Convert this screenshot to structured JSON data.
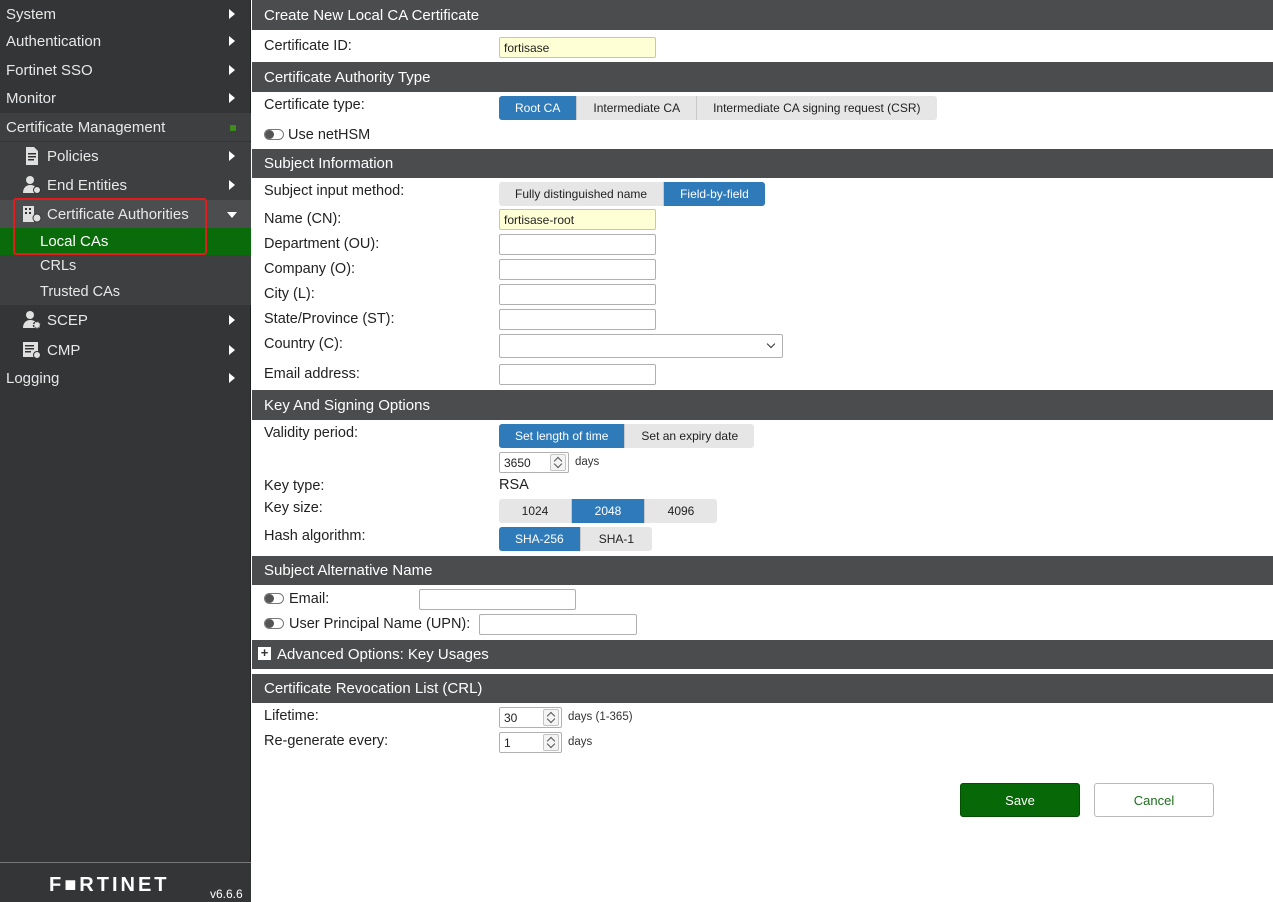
{
  "sidebar": {
    "items": [
      {
        "label": "System"
      },
      {
        "label": "Authentication"
      },
      {
        "label": "Fortinet SSO"
      },
      {
        "label": "Monitor"
      },
      {
        "label": "Certificate Management"
      },
      {
        "label": "Policies"
      },
      {
        "label": "End Entities"
      },
      {
        "label": "Certificate Authorities"
      },
      {
        "label": "Local CAs"
      },
      {
        "label": "CRLs"
      },
      {
        "label": "Trusted CAs"
      },
      {
        "label": "SCEP"
      },
      {
        "label": "CMP"
      },
      {
        "label": "Logging"
      }
    ],
    "brand": "F■RTINET",
    "version": "v6.6.6"
  },
  "form": {
    "title": "Create New Local CA Certificate",
    "certificate_id_label": "Certificate ID:",
    "certificate_id_value": "fortisase",
    "ca_type_header": "Certificate Authority Type",
    "cert_type_label": "Certificate type:",
    "cert_type_options": [
      "Root CA",
      "Intermediate CA",
      "Intermediate CA signing request (CSR)"
    ],
    "cert_type_selected": "Root CA",
    "use_nethsm_label": "Use netHSM",
    "subject_header": "Subject Information",
    "subject_method_label": "Subject input method:",
    "subject_method_options": [
      "Fully distinguished name",
      "Field-by-field"
    ],
    "subject_method_selected": "Field-by-field",
    "name_cn_label": "Name (CN):",
    "name_cn_value": "fortisase-root",
    "department_label": "Department (OU):",
    "company_label": "Company (O):",
    "city_label": "City (L):",
    "state_label": "State/Province (ST):",
    "country_label": "Country (C):",
    "email_label": "Email address:",
    "key_header": "Key And Signing Options",
    "validity_label": "Validity period:",
    "validity_options": [
      "Set length of time",
      "Set an expiry date"
    ],
    "validity_selected": "Set length of time",
    "validity_days": "3650",
    "days_unit": "days",
    "key_type_label": "Key type:",
    "key_type_value": "RSA",
    "key_size_label": "Key size:",
    "key_size_options": [
      "1024",
      "2048",
      "4096"
    ],
    "key_size_selected": "2048",
    "hash_label": "Hash algorithm:",
    "hash_options": [
      "SHA-256",
      "SHA-1"
    ],
    "hash_selected": "SHA-256",
    "san_header": "Subject Alternative Name",
    "san_email_label": "Email:",
    "san_upn_label": "User Principal Name (UPN):",
    "advanced_header": "Advanced Options: Key Usages",
    "crl_header": "Certificate Revocation List (CRL)",
    "lifetime_label": "Lifetime:",
    "lifetime_value": "30",
    "lifetime_unit": "days (1-365)",
    "regen_label": "Re-generate every:",
    "regen_value": "1",
    "regen_unit": "days",
    "save_label": "Save",
    "cancel_label": "Cancel"
  },
  "colors": {
    "selected_segment": "#2f7ab8",
    "active_nav": "#0a6b0a",
    "save_button": "#066806",
    "section_header": "#4a4c4d"
  }
}
